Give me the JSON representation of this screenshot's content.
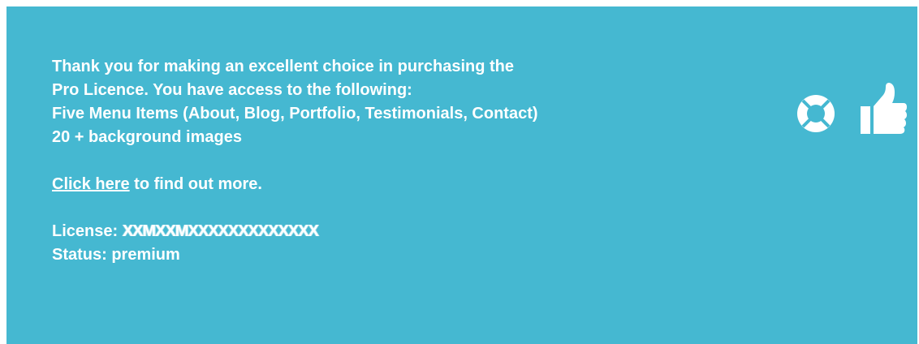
{
  "notice": {
    "line1": "Thank you for making an excellent choice in purchasing the",
    "line2": "Pro Licence. You have access to the following:",
    "line3": "Five Menu Items (About, Blog, Portfolio, Testimonials, Contact)",
    "line4": "20 + background images",
    "link_text": "Click here",
    "link_suffix": " to find out more.",
    "license_label": "License: ",
    "license_value": "XXMXXMXXXXXXXXXXXXX",
    "status_label": "Status: premium"
  },
  "colors": {
    "panel_background": "#45b8d1",
    "text": "#ffffff"
  },
  "icons": [
    "life-ring-icon",
    "thumbs-up-icon"
  ]
}
